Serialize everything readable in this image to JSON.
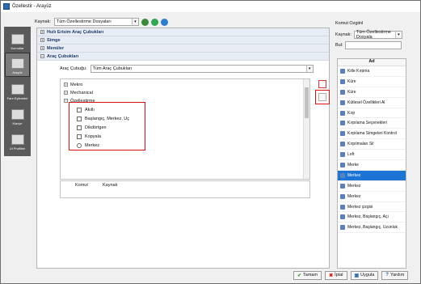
{
  "window": {
    "title": "Özellestir - Arayüz"
  },
  "left_nav": [
    {
      "label": "Komutlar"
    },
    {
      "label": "Arayüz"
    },
    {
      "label": "Fare Eylemleri"
    },
    {
      "label": "Klavye"
    },
    {
      "label": "UI Profilleri"
    }
  ],
  "toolbar": {
    "source_label": "Kaynak:",
    "source_value": "Tüm Özellestirme Dosyaları"
  },
  "sections": [
    {
      "label": "Hızlı Erisim Araç Çubukları"
    },
    {
      "label": "Simge"
    },
    {
      "label": "Menüler"
    },
    {
      "label": "Araç Çubukları"
    }
  ],
  "toolbars": {
    "label": "Araç Çubuğu:",
    "value": "Tüm Araç Çubukları",
    "tree": {
      "groups": [
        "Mekro",
        "Mechanical",
        "Özellestirme"
      ],
      "items": [
        "Akıllı",
        "Başlangıç, Merkez, Uç",
        "Dikdörtgen",
        "Kopyala",
        "Merkez"
      ]
    },
    "table_headers": [
      "Komut",
      "Kaynak"
    ]
  },
  "command_panel": {
    "title": "Komut Ozgiinl",
    "source_label": "Kaynak:",
    "source_value": "Tüm Özellestirme Dosyala",
    "search_label": "Bul:",
    "search_value": "",
    "column_header": "Ad",
    "items": [
      "Kitle Kırpma",
      "Küre",
      "Küre",
      "Kütlesel Özellikleri Al",
      "Kırp",
      "Kırpılama Seçenekleri",
      "Kırpılama Simgeleri Kontrol",
      "Kırpılmaları Sil",
      "Loft",
      "Merke",
      "Merkez",
      "Merkez",
      "Merkez",
      "Merkez çizgisi",
      "Merkez, Başlangıç, Açı",
      "Merkez, Başlangıç, Uzunluk"
    ],
    "selected_index": 10
  },
  "buttons": {
    "ok": "Tamam",
    "cancel": "İptal",
    "apply": "Uygula",
    "help": "Yardım"
  }
}
